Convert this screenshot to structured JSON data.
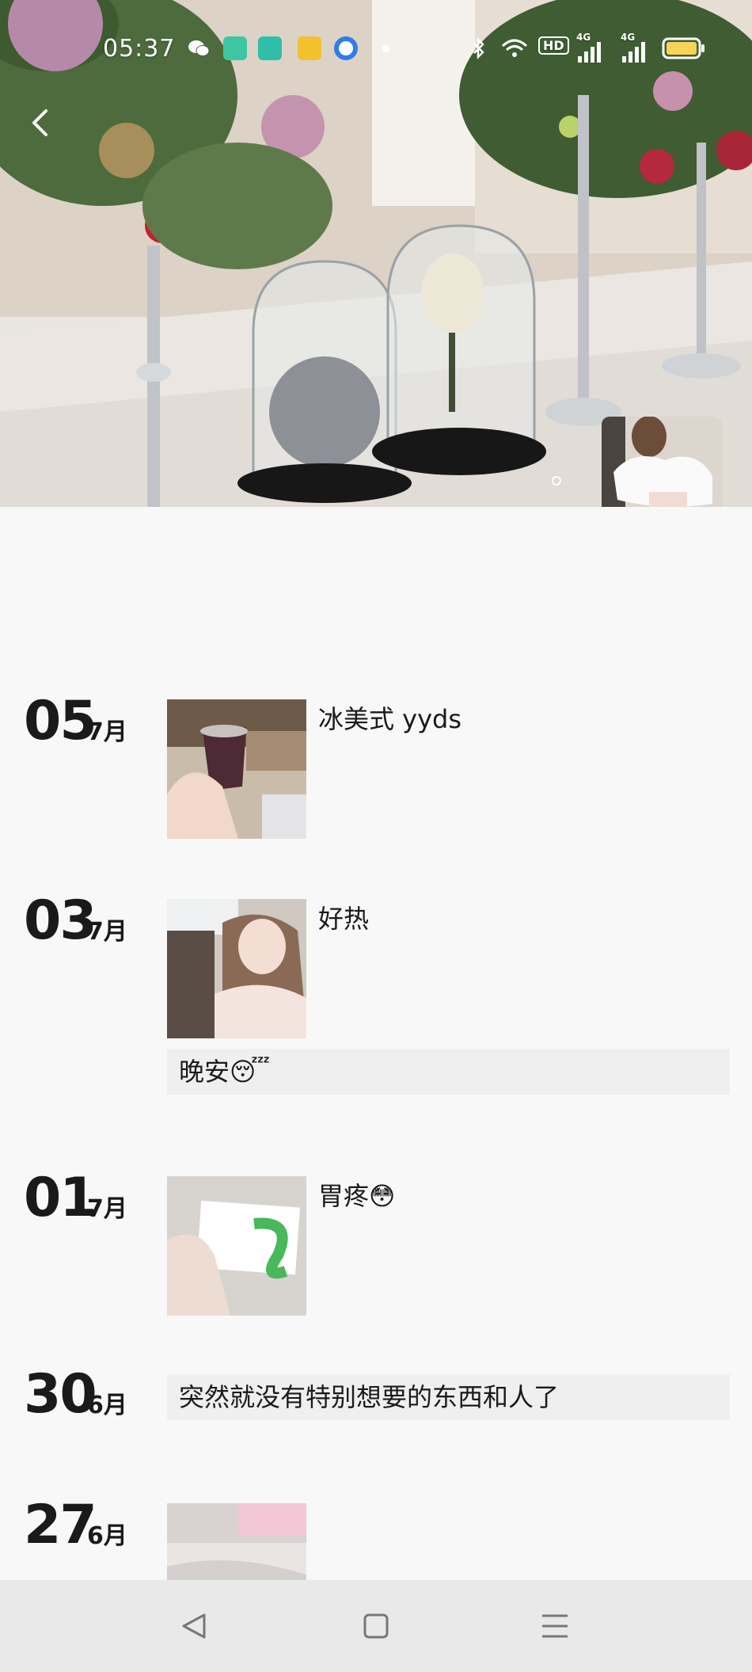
{
  "status_bar": {
    "time": "05:37",
    "hd_label": "HD",
    "net1": "4G",
    "net2": "4G",
    "icons": [
      "wechat-icon",
      "app-green-icon",
      "app-teal-icon",
      "app-yellow-icon",
      "app-blue-icon",
      "dot-icon",
      "bluetooth-icon",
      "wifi-icon",
      "signal-icon",
      "battery-icon"
    ]
  },
  "colors": {
    "battery": "#f5d45a",
    "app_green": "#3cc7a2",
    "app_teal": "#2fbfa8",
    "app_yellow": "#f2c12e",
    "app_blue": "#2f7de6"
  },
  "posts": [
    {
      "day": "05",
      "month": "7月",
      "caption": "冰美式 yyds",
      "has_photo": true,
      "photo": "iced-coffee-photo"
    },
    {
      "day": "03",
      "month": "7月",
      "caption": "好热",
      "has_photo": true,
      "photo": "selfie-photo",
      "text_post": "晚安😴"
    },
    {
      "day": "01",
      "month": "7月",
      "caption": "胃疼😳",
      "has_photo": true,
      "photo": "medicine-box-photo"
    },
    {
      "day": "30",
      "month": "6月",
      "text_post": "突然就没有特别想要的东西和人了",
      "has_photo": false
    },
    {
      "day": "27",
      "month": "6月",
      "has_photo": true,
      "photo": "bedroom-photo"
    }
  ],
  "nav": {
    "back": "back-triangle-icon",
    "home": "home-square-icon",
    "menu": "menu-lines-icon"
  }
}
